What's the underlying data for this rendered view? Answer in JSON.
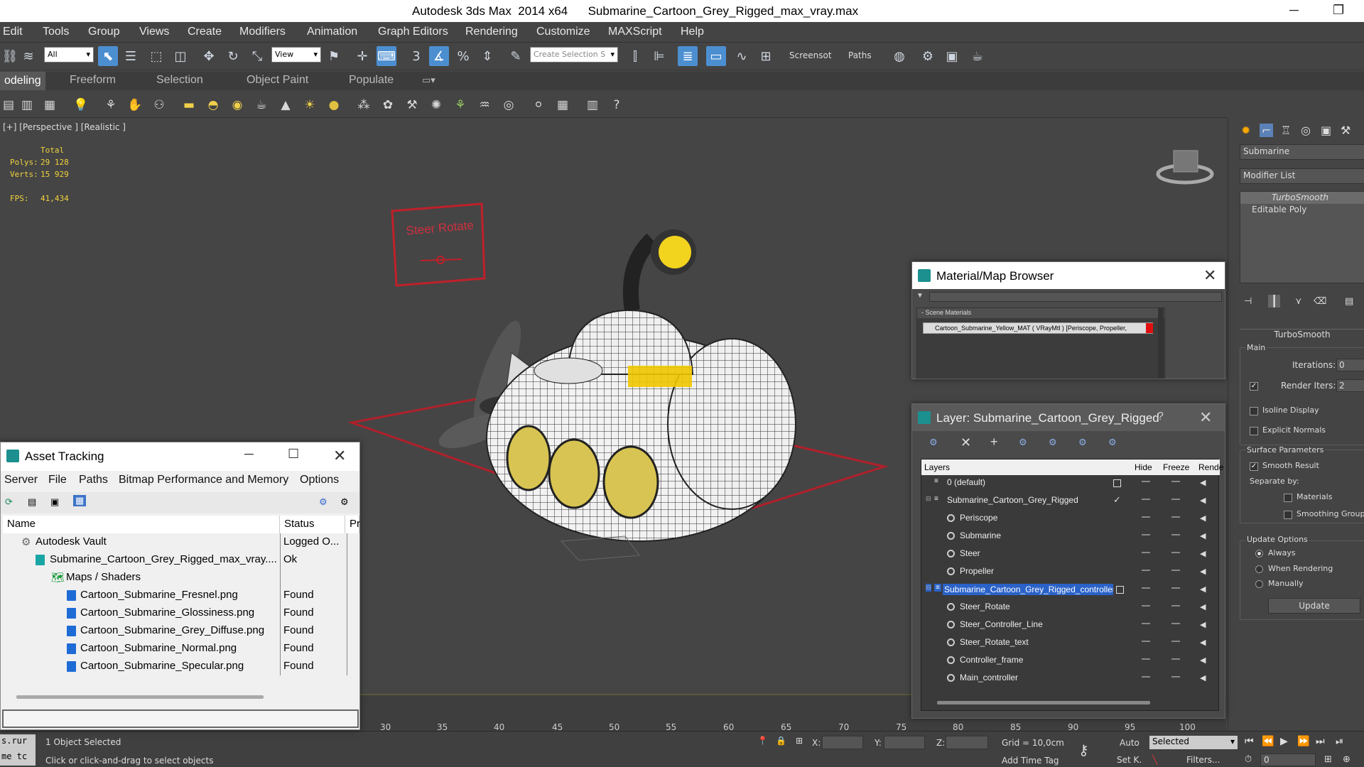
{
  "window": {
    "title": "Autodesk 3ds Max  2014 x64      Submarine_Cartoon_Grey_Rigged_max_vray.max",
    "minimize": "─",
    "maximize": "❐"
  },
  "menu": [
    "Edit",
    "Tools",
    "Group",
    "Views",
    "Create",
    "Modifiers",
    "Animation",
    "Graph Editors",
    "Rendering",
    "Customize",
    "MAXScript",
    "Help"
  ],
  "toolbar": {
    "filter_value": "All",
    "view_value": "View",
    "selection_set_placeholder": "Create Selection S",
    "screenshot_label": "Screensot",
    "paths_label": "Paths"
  },
  "ribbon": {
    "tabs": [
      "odeling",
      "Freeform",
      "Selection",
      "Object Paint",
      "Populate"
    ]
  },
  "viewport": {
    "label": "[+] [Perspective ] [Realistic ]",
    "stats": {
      "total_label": "Total",
      "polys_label": "Polys:",
      "polys_value": "29 128",
      "verts_label": "Verts:",
      "verts_value": "15 929",
      "fps_label": "FPS:",
      "fps_value": "41,434"
    },
    "controller_text": "Steer Rotate"
  },
  "asset_tracking": {
    "title": "Asset Tracking",
    "menu": [
      "Server",
      "File",
      "Paths",
      "Bitmap Performance and Memory",
      "Options"
    ],
    "columns": {
      "name": "Name",
      "status": "Status",
      "extra": "Pr"
    },
    "rows": [
      {
        "name": "Autodesk Vault",
        "status": "Logged O..."
      },
      {
        "name": "Submarine_Cartoon_Grey_Rigged_max_vray....",
        "status": "Ok"
      },
      {
        "name": "Maps / Shaders",
        "status": ""
      },
      {
        "name": "Cartoon_Submarine_Fresnel.png",
        "status": "Found"
      },
      {
        "name": "Cartoon_Submarine_Glossiness.png",
        "status": "Found"
      },
      {
        "name": "Cartoon_Submarine_Grey_Diffuse.png",
        "status": "Found"
      },
      {
        "name": "Cartoon_Submarine_Normal.png",
        "status": "Found"
      },
      {
        "name": "Cartoon_Submarine_Specular.png",
        "status": "Found"
      }
    ]
  },
  "material_browser": {
    "title": "Material/Map Browser",
    "section": "- Scene Materials",
    "item": "Cartoon_Submarine_Yellow_MAT ( VRayMtl ) [Periscope, Propeller,"
  },
  "layer_explorer": {
    "title": "Layer: Submarine_Cartoon_Grey_Rigged",
    "help": "?",
    "columns": {
      "layers": "Layers",
      "hide": "Hide",
      "freeze": "Freeze",
      "render": "Rende"
    },
    "rows": [
      {
        "name": "0 (default)",
        "indent": 1,
        "type": "layer"
      },
      {
        "name": "Submarine_Cartoon_Grey_Rigged",
        "indent": 1,
        "type": "layer",
        "current": true
      },
      {
        "name": "Periscope",
        "indent": 2,
        "type": "object"
      },
      {
        "name": "Submarine",
        "indent": 2,
        "type": "object"
      },
      {
        "name": "Steer",
        "indent": 2,
        "type": "object"
      },
      {
        "name": "Propeller",
        "indent": 2,
        "type": "object"
      },
      {
        "name": "Submarine_Cartoon_Grey_Rigged_controllers",
        "indent": 1,
        "type": "layer",
        "selected": true
      },
      {
        "name": "Steer_Rotate",
        "indent": 2,
        "type": "object"
      },
      {
        "name": "Steer_Controller_Line",
        "indent": 2,
        "type": "object"
      },
      {
        "name": "Steer_Rotate_text",
        "indent": 2,
        "type": "object"
      },
      {
        "name": "Controller_frame",
        "indent": 2,
        "type": "object"
      },
      {
        "name": "Main_controller",
        "indent": 2,
        "type": "object"
      }
    ]
  },
  "command_panel": {
    "object_name": "Submarine",
    "modifier_list_label": "Modifier List",
    "stack": [
      "TurboSmooth",
      "Editable Poly"
    ],
    "rollout_title": "TurboSmooth",
    "main_label": "Main",
    "iterations_label": "Iterations:",
    "iterations_value": "0",
    "render_iters_label": "Render Iters:",
    "render_iters_value": "2",
    "isoline_label": "Isoline Display",
    "explicit_normals_label": "Explicit Normals",
    "surface_params_label": "Surface Parameters",
    "smooth_result_label": "Smooth Result",
    "separate_by_label": "Separate by:",
    "materials_label": "Materials",
    "smoothing_groups_label": "Smoothing Groups",
    "update_options_label": "Update Options",
    "always_label": "Always",
    "when_rendering_label": "When Rendering",
    "manually_label": "Manually",
    "update_button": "Update"
  },
  "timeline": {
    "ticks": [
      "30",
      "35",
      "40",
      "45",
      "50",
      "55",
      "60",
      "65",
      "70",
      "75",
      "80",
      "85",
      "90",
      "95",
      "100"
    ]
  },
  "status": {
    "script_line1": "s.rur",
    "script_line2": "me tc",
    "selected": "1 Object Selected",
    "prompt": "Click or click-and-drag to select objects",
    "x_label": "X:",
    "y_label": "Y:",
    "z_label": "Z:",
    "grid": "Grid = 10,0cm",
    "add_time_tag": "Add Time Tag",
    "auto": "Auto",
    "set_key": "Set K.",
    "selected_dropdown": "Selected",
    "filters": "Filters...",
    "frame": "0"
  }
}
